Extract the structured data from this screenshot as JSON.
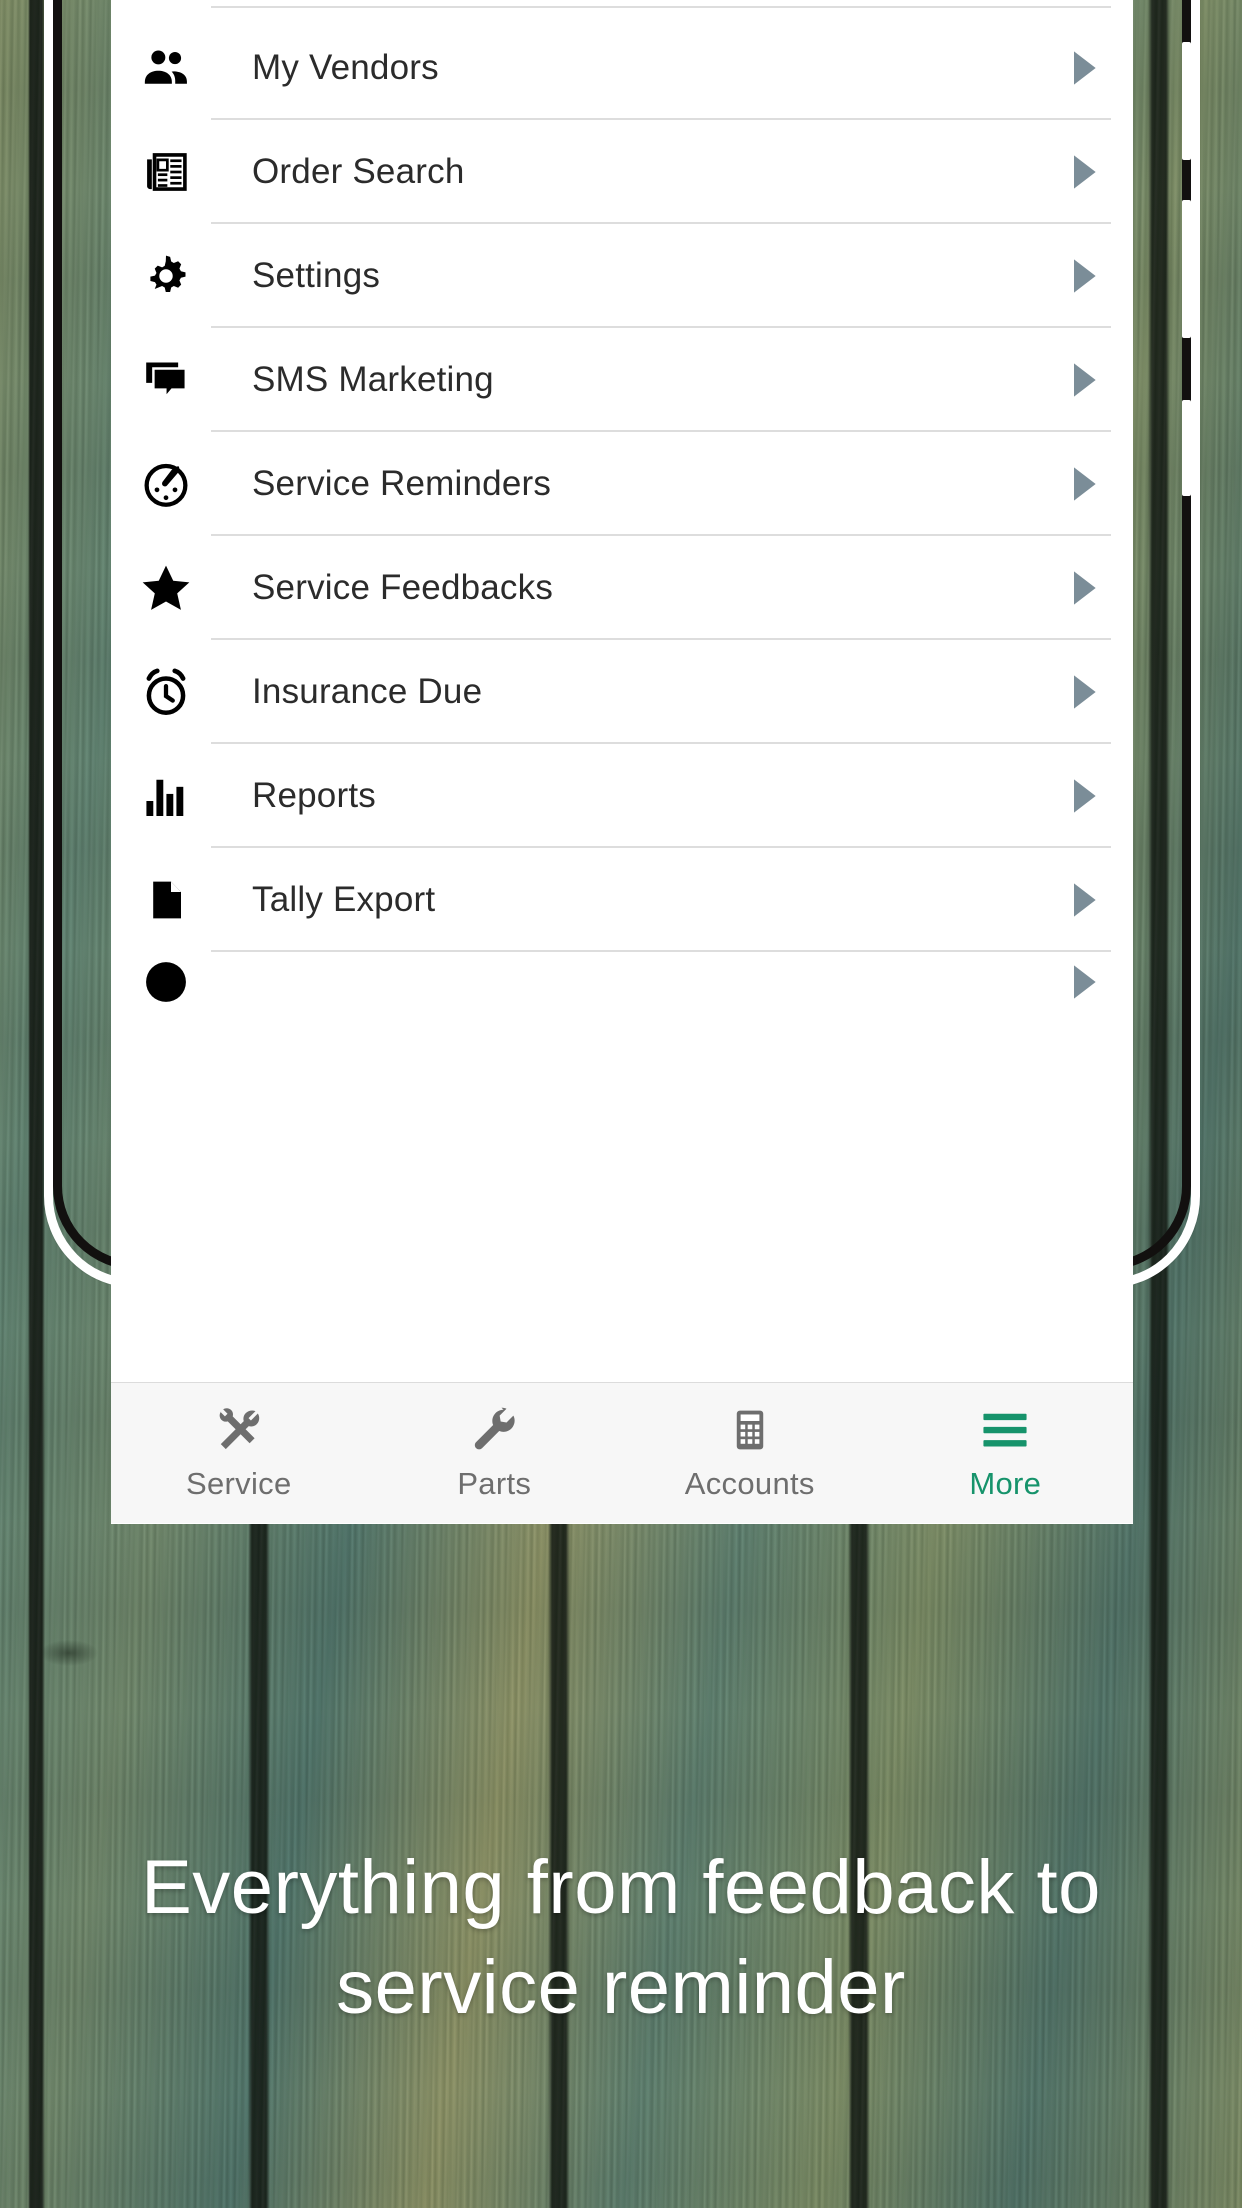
{
  "app": {
    "accent_green": "#16936b",
    "arrow_color": "#7b8d98",
    "caption_line1": "Everything from feedback to",
    "caption_line2": "service reminder"
  },
  "menu": {
    "items": [
      {
        "label": "My Vendors",
        "icon": "people-icon"
      },
      {
        "label": "Order Search",
        "icon": "newspaper-icon"
      },
      {
        "label": "Settings",
        "icon": "gear-icon"
      },
      {
        "label": "SMS Marketing",
        "icon": "chat-bubble-icon"
      },
      {
        "label": "Service Reminders",
        "icon": "speedometer-icon"
      },
      {
        "label": "Service Feedbacks",
        "icon": "star-icon"
      },
      {
        "label": "Insurance Due",
        "icon": "alarm-clock-icon"
      },
      {
        "label": "Reports",
        "icon": "bar-chart-icon"
      },
      {
        "label": "Tally Export",
        "icon": "document-icon"
      }
    ]
  },
  "tabbar": {
    "tabs": [
      {
        "label": "Service",
        "icon": "tools-icon",
        "active": false
      },
      {
        "label": "Parts",
        "icon": "wrench-icon",
        "active": false
      },
      {
        "label": "Accounts",
        "icon": "calculator-icon",
        "active": false
      },
      {
        "label": "More",
        "icon": "hamburger-icon",
        "active": true
      }
    ]
  }
}
